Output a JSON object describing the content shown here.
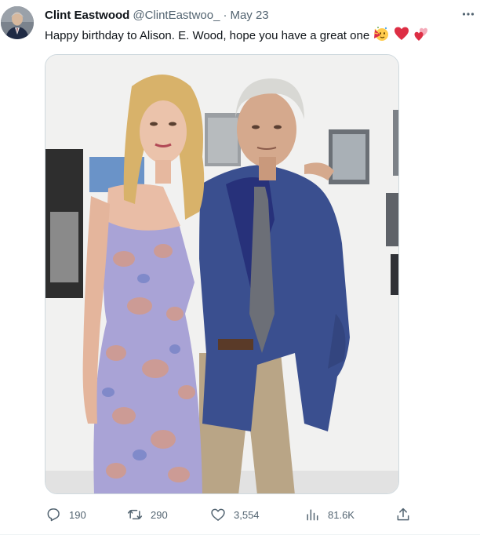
{
  "tweet": {
    "author": {
      "display_name": "Clint Eastwood",
      "handle": "@ClintEastwoo_",
      "avatar_icon": "profile-avatar"
    },
    "separator": "·",
    "date": "May 23",
    "text": "Happy birthday to Alison. E. Wood, hope you have a great one",
    "emojis": [
      "party-face-icon",
      "red-heart-icon",
      "two-hearts-icon"
    ],
    "media": {
      "kind": "photo"
    },
    "actions": {
      "reply": {
        "icon": "reply-icon",
        "count": "190"
      },
      "retweet": {
        "icon": "retweet-icon",
        "count": "290"
      },
      "like": {
        "icon": "heart-icon",
        "count": "3,554"
      },
      "views": {
        "icon": "analytics-icon",
        "count": "81.6K"
      },
      "share": {
        "icon": "share-icon"
      }
    },
    "more_icon": "more-options-icon"
  },
  "colors": {
    "text_primary": "#0f1419",
    "text_secondary": "#536471",
    "border": "#cfd9de",
    "heart": "#e0245e"
  }
}
